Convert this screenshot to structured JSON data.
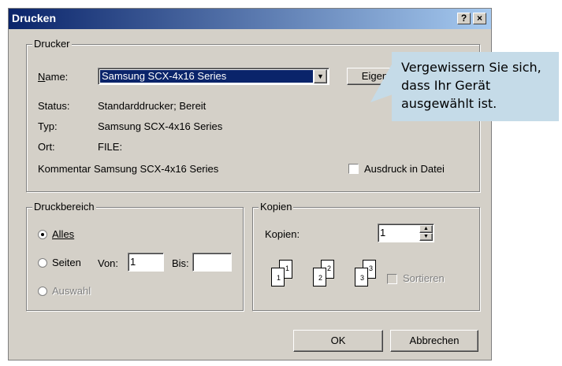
{
  "window": {
    "title": "Drucken",
    "help_btn": "?",
    "close_btn": "×"
  },
  "printer_group": {
    "legend": "Drucker",
    "name_label": "Name:",
    "name_value": "Samsung SCX-4x16 Series",
    "properties_btn": "Eigenschaften",
    "status_label": "Status:",
    "status_value": "Standarddrucker; Bereit",
    "type_label": "Typ:",
    "type_value": "Samsung SCX-4x16 Series",
    "location_label": "Ort:",
    "location_value": "FILE:",
    "comment_label": "Kommentar",
    "comment_value": "Samsung SCX-4x16 Series",
    "print_to_file": "Ausdruck in Datei",
    "print_to_file_checked": false
  },
  "range_group": {
    "legend": "Druckbereich",
    "all": "Alles",
    "pages": "Seiten",
    "from_label": "Von:",
    "from_value": "1",
    "to_label": "Bis:",
    "to_value": "",
    "selection": "Auswahl",
    "selected": "all"
  },
  "copies_group": {
    "legend": "Kopien",
    "copies_label": "Kopien:",
    "copies_value": "1",
    "collate": "Sortieren",
    "collate_checked": false,
    "page_icons": [
      "1",
      "2",
      "3"
    ]
  },
  "buttons": {
    "ok": "OK",
    "cancel": "Abbrechen"
  },
  "callout": {
    "lines": [
      "Vergewissern Sie sich,",
      "dass Ihr Gerät",
      "ausgewählt ist."
    ],
    "color": "#c5dbe8"
  }
}
